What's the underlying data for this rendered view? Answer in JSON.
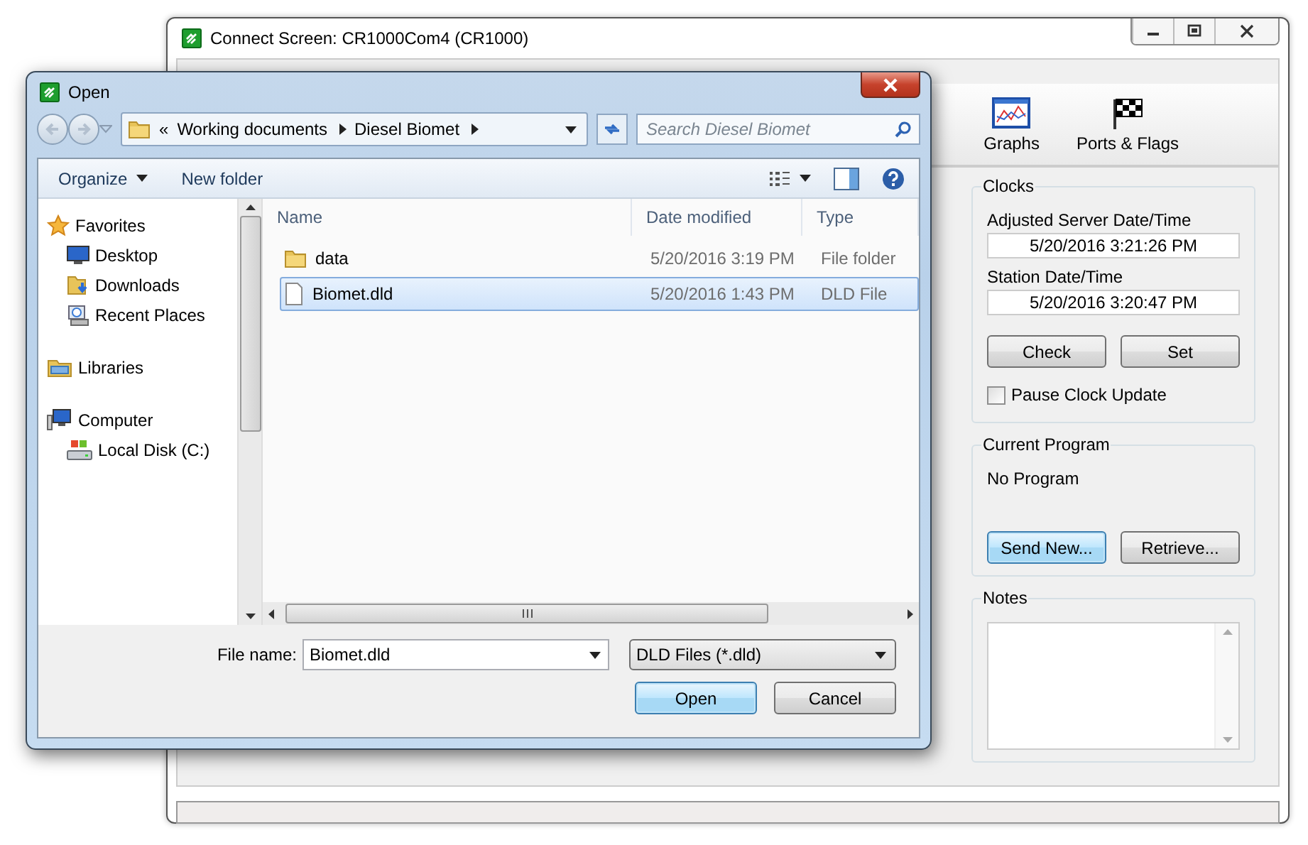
{
  "main_window": {
    "title": "Connect Screen: CR1000Com4 (CR1000)",
    "toolbar": [
      {
        "label": "Graphs",
        "kind": "graph"
      },
      {
        "label": "Ports & Flags",
        "kind": "flag"
      }
    ],
    "clocks": {
      "title": "Clocks",
      "fields": [
        {
          "label": "Adjusted Server Date/Time",
          "value": "5/20/2016 3:21:26 PM"
        },
        {
          "label": "Station Date/Time",
          "value": "5/20/2016 3:20:47 PM"
        }
      ],
      "buttons": [
        {
          "label": "Check",
          "default": false
        },
        {
          "label": "Set",
          "default": false
        }
      ],
      "pause_checkbox": {
        "label": "Pause Clock Update",
        "checked": false
      }
    },
    "current_program": {
      "title": "Current Program",
      "value": "No Program",
      "buttons": [
        {
          "label": "Send New...",
          "default": true
        },
        {
          "label": "Retrieve...",
          "default": false
        }
      ]
    },
    "notes": {
      "title": "Notes"
    }
  },
  "dialog": {
    "title": "Open",
    "address": {
      "overflow": "«",
      "path": [
        "Working documents",
        "Diesel Biomet"
      ]
    },
    "search": {
      "placeholder": "Search Diesel Biomet"
    },
    "toolbar": [
      {
        "label": "Organize",
        "dropdown": true
      },
      {
        "label": "New folder",
        "dropdown": false
      }
    ],
    "nav": [
      {
        "label": "Favorites",
        "kind": "star",
        "children": [
          {
            "label": "Desktop",
            "kind": "desktop"
          },
          {
            "label": "Downloads",
            "kind": "downloads"
          },
          {
            "label": "Recent Places",
            "kind": "recent"
          }
        ]
      },
      {
        "label": "Libraries",
        "kind": "libraries"
      },
      {
        "label": "Computer",
        "kind": "computer",
        "children": [
          {
            "label": "Local Disk (C:)",
            "kind": "disk"
          }
        ]
      }
    ],
    "columns": [
      "Name",
      "Date modified",
      "Type"
    ],
    "rows": [
      {
        "name": "data",
        "date": "5/20/2016 3:19 PM",
        "type": "File folder",
        "kind": "folder",
        "selected": false
      },
      {
        "name": "Biomet.dld",
        "date": "5/20/2016 1:43 PM",
        "type": "DLD File",
        "kind": "file",
        "selected": true
      }
    ],
    "file_name_label": "File name:",
    "file_name": "Biomet.dld",
    "file_type": "DLD Files (*.dld)",
    "buttons": [
      {
        "label": "Open",
        "default": true
      },
      {
        "label": "Cancel",
        "default": false
      }
    ]
  }
}
